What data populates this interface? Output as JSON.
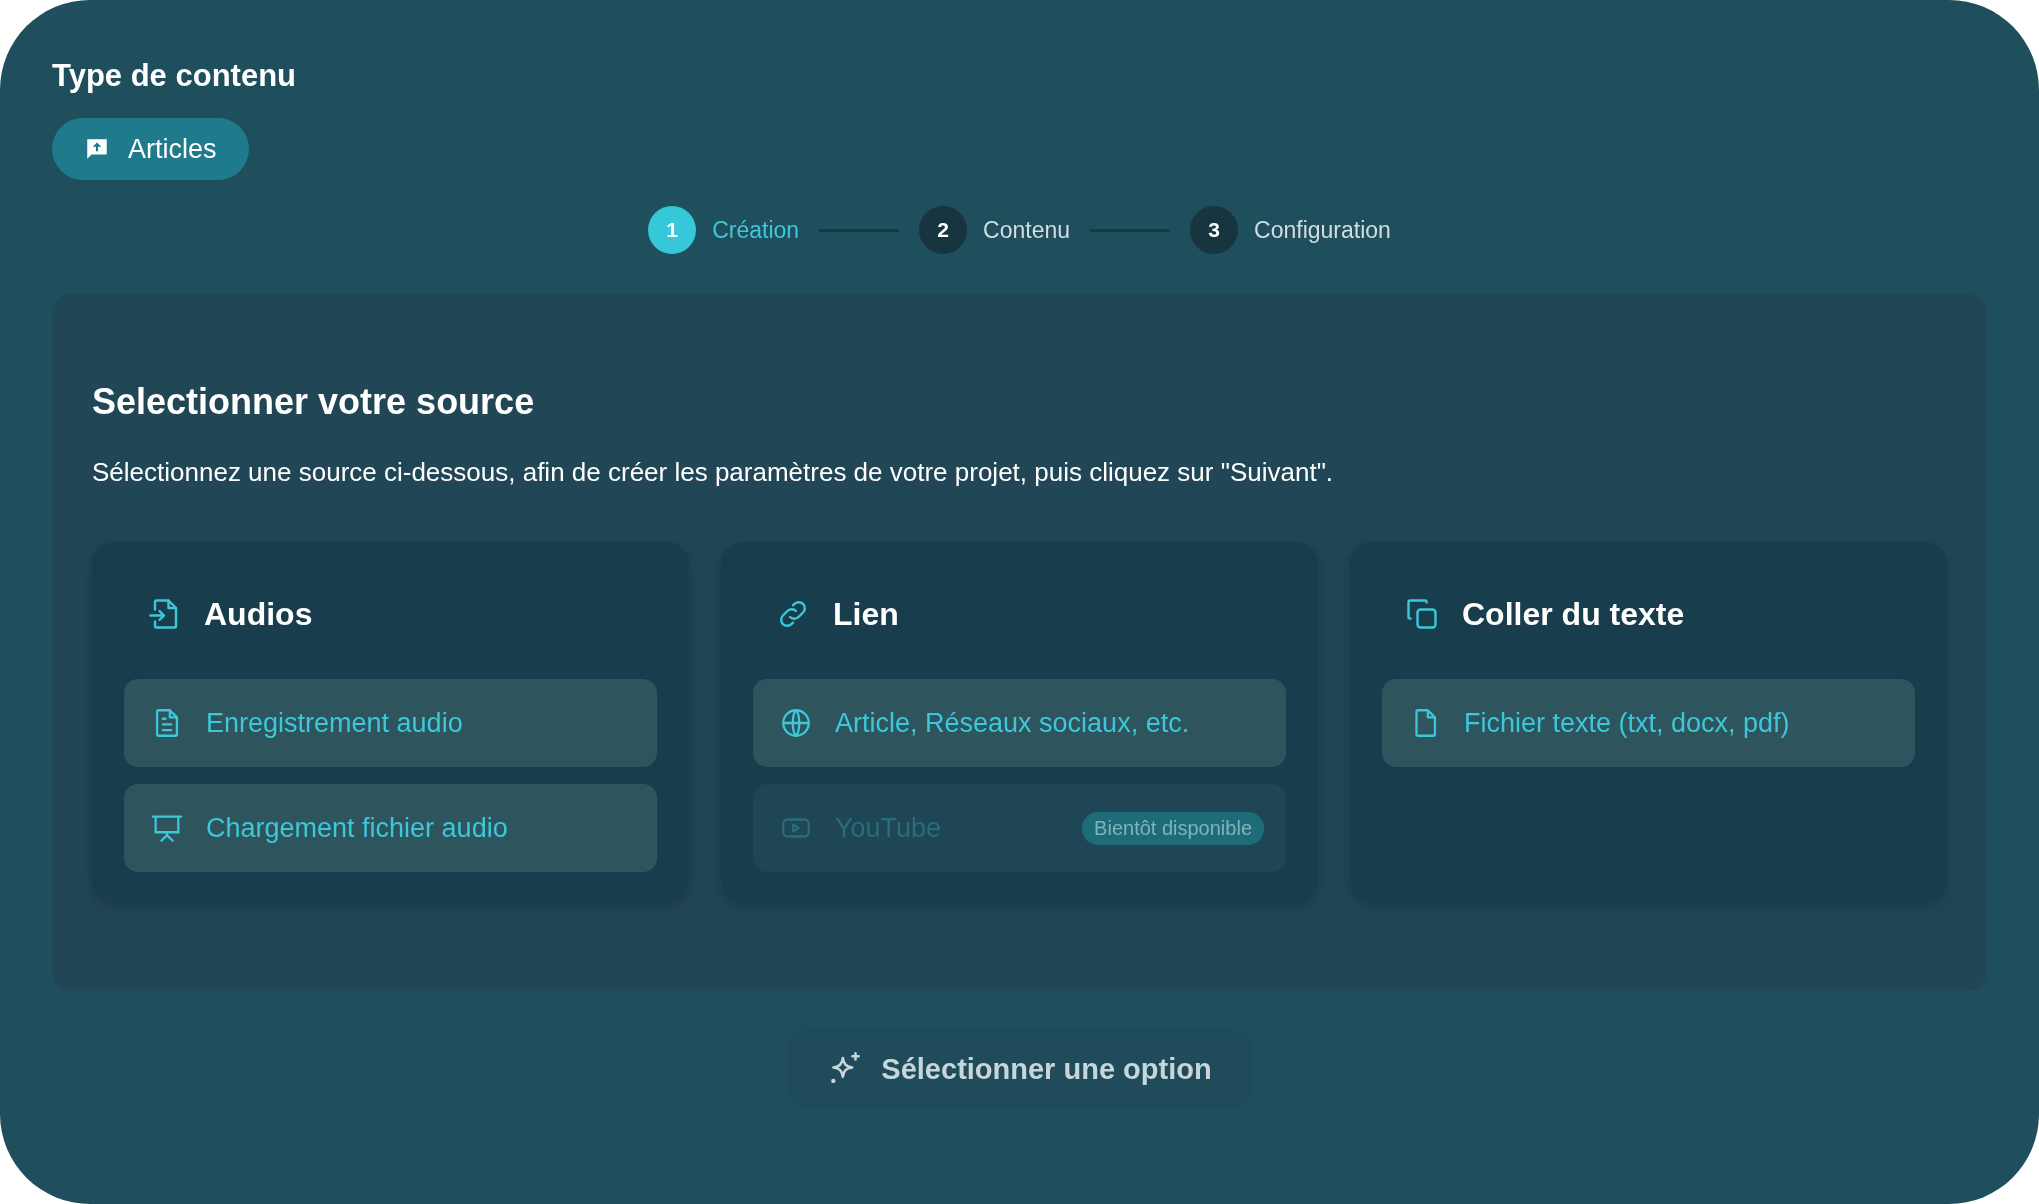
{
  "content_type": {
    "title": "Type de contenu",
    "chip": "Articles"
  },
  "steps": [
    {
      "number": "1",
      "label": "Création",
      "selected": true
    },
    {
      "number": "2",
      "label": "Contenu",
      "selected": false
    },
    {
      "number": "3",
      "label": "Configuration",
      "selected": false
    }
  ],
  "panel": {
    "title": "Selectionner votre source",
    "description": "Sélectionnez une source ci-dessous, afin de créer les paramètres de votre projet, puis cliquez sur \"Suivant\".",
    "cards": [
      {
        "title": "Audios",
        "kind": "import",
        "options": [
          {
            "label": "Enregistrement audio",
            "kind": "document",
            "disabled": false
          },
          {
            "label": "Chargement fichier audio",
            "kind": "presentation",
            "disabled": false
          }
        ]
      },
      {
        "title": "Lien",
        "kind": "link",
        "options": [
          {
            "label": "Article, Réseaux sociaux, etc.",
            "kind": "globe",
            "disabled": false
          },
          {
            "label": "YouTube",
            "kind": "video",
            "disabled": true,
            "badge": "Bientôt disponible"
          }
        ]
      },
      {
        "title": "Coller du texte",
        "kind": "copy",
        "options": [
          {
            "label": "Fichier texte (txt, docx, pdf)",
            "kind": "file",
            "disabled": false
          }
        ]
      }
    ]
  },
  "action_button": {
    "label": "Sélectionner une option",
    "disabled": true
  }
}
